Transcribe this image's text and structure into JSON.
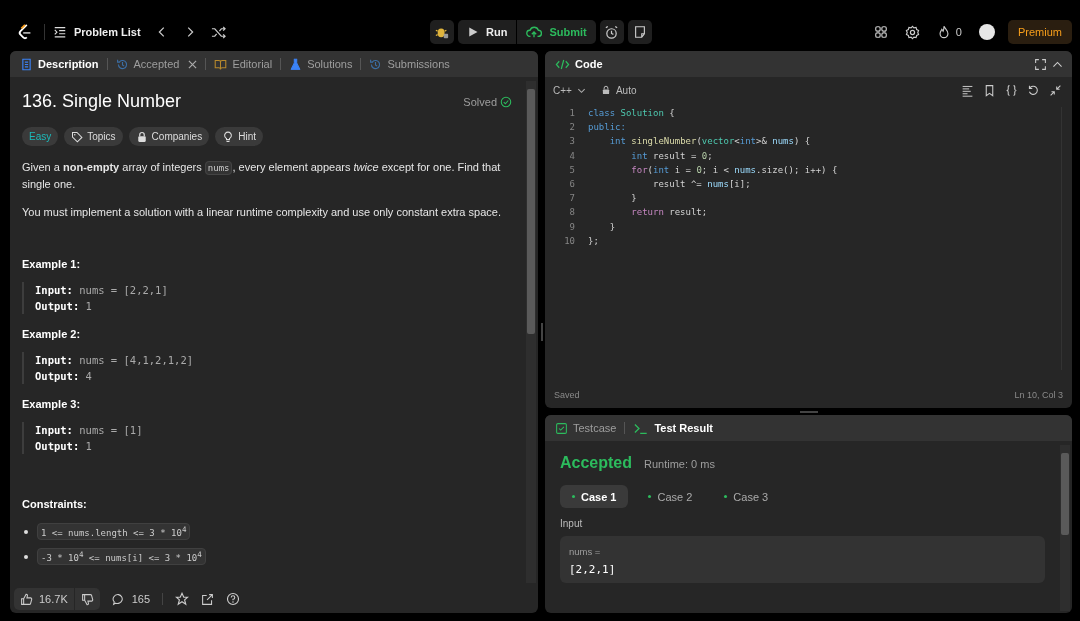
{
  "topbar": {
    "problem_list": "Problem List",
    "run": "Run",
    "submit": "Submit",
    "streak": "0",
    "premium": "Premium"
  },
  "description_panel": {
    "tabs": [
      {
        "label": "Description",
        "selected": true,
        "closable": false
      },
      {
        "label": "Accepted",
        "selected": false,
        "closable": true
      },
      {
        "label": "Editorial",
        "selected": false,
        "closable": false
      },
      {
        "label": "Solutions",
        "selected": false,
        "closable": false
      },
      {
        "label": "Submissions",
        "selected": false,
        "closable": false
      }
    ],
    "title": "136. Single Number",
    "status": "Solved",
    "tags": [
      {
        "label": "Easy",
        "kind": "difficulty"
      },
      {
        "label": "Topics",
        "kind": "tag"
      },
      {
        "label": "Companies",
        "kind": "lock"
      },
      {
        "label": "Hint",
        "kind": "bulb"
      }
    ],
    "paragraphs": [
      [
        {
          "kind": "text",
          "text": "Given a **non-empty** array of integers "
        },
        {
          "kind": "code",
          "text": "nums"
        },
        {
          "kind": "text",
          "text": ", every element appears *twice* except for one. Find that single one."
        }
      ],
      [
        {
          "kind": "text",
          "text": "You must implement a solution with a linear runtime complexity and use only constant extra space."
        }
      ]
    ],
    "examples": [
      {
        "title": "Example 1:",
        "lines": [
          {
            "label": "Input:",
            "value": "nums = [2,2,1]"
          },
          {
            "label": "Output:",
            "value": "1"
          }
        ]
      },
      {
        "title": "Example 2:",
        "lines": [
          {
            "label": "Input:",
            "value": "nums = [4,1,2,1,2]"
          },
          {
            "label": "Output:",
            "value": "4"
          }
        ]
      },
      {
        "title": "Example 3:",
        "lines": [
          {
            "label": "Input:",
            "value": "nums = [1]"
          },
          {
            "label": "Output:",
            "value": "1"
          }
        ]
      }
    ],
    "constraints_title": "Constraints:",
    "constraints": [
      "1 <= nums.length <= 3 * 10$^{4}$",
      "-3 * 10$^{4}$ <= nums[i] <= 3 * 10$^{4}$"
    ],
    "likes": "16.7K",
    "comments": "165"
  },
  "code_panel": {
    "title": "Code",
    "language": "C++",
    "mode": "Auto",
    "status": "Saved",
    "cursor": "Ln 10, Col 3",
    "lines": [
      {
        "number": "1",
        "tokens": [
          {
            "kind": "keyword",
            "text": "class "
          },
          {
            "kind": "type",
            "text": "Solution"
          },
          {
            "kind": "plain",
            "text": " {"
          }
        ]
      },
      {
        "number": "2",
        "tokens": [
          {
            "kind": "keyword",
            "text": "public:"
          }
        ]
      },
      {
        "number": "3",
        "tokens": [
          {
            "kind": "keyword",
            "text": "    int "
          },
          {
            "kind": "function",
            "text": "singleNumber"
          },
          {
            "kind": "plain",
            "text": "("
          },
          {
            "kind": "type",
            "text": "vector"
          },
          {
            "kind": "plain",
            "text": "<"
          },
          {
            "kind": "keyword",
            "text": "int"
          },
          {
            "kind": "plain",
            "text": ">& "
          },
          {
            "kind": "variable",
            "text": "nums"
          },
          {
            "kind": "plain",
            "text": ") {"
          }
        ]
      },
      {
        "number": "4",
        "tokens": [
          {
            "kind": "keyword",
            "text": "        int "
          },
          {
            "kind": "plain",
            "text": "result = "
          },
          {
            "kind": "number",
            "text": "0"
          },
          {
            "kind": "plain",
            "text": ";"
          }
        ]
      },
      {
        "number": "5",
        "tokens": [
          {
            "kind": "control",
            "text": "        for"
          },
          {
            "kind": "plain",
            "text": "("
          },
          {
            "kind": "keyword",
            "text": "int "
          },
          {
            "kind": "plain",
            "text": "i = "
          },
          {
            "kind": "number",
            "text": "0"
          },
          {
            "kind": "plain",
            "text": "; i < "
          },
          {
            "kind": "variable",
            "text": "nums"
          },
          {
            "kind": "plain",
            "text": ".size(); i++) {"
          }
        ]
      },
      {
        "number": "6",
        "tokens": [
          {
            "kind": "plain",
            "text": "            result ^= "
          },
          {
            "kind": "variable",
            "text": "nums"
          },
          {
            "kind": "plain",
            "text": "[i];"
          }
        ]
      },
      {
        "number": "7",
        "tokens": [
          {
            "kind": "plain",
            "text": "        }"
          }
        ]
      },
      {
        "number": "8",
        "tokens": [
          {
            "kind": "control",
            "text": "        return "
          },
          {
            "kind": "plain",
            "text": "result;"
          }
        ]
      },
      {
        "number": "9",
        "tokens": [
          {
            "kind": "plain",
            "text": "    }"
          }
        ]
      },
      {
        "number": "10",
        "tokens": [
          {
            "kind": "plain",
            "text": "};"
          }
        ]
      }
    ]
  },
  "result_panel": {
    "tabs": [
      {
        "label": "Testcase",
        "selected": false
      },
      {
        "label": "Test Result",
        "selected": true
      }
    ],
    "verdict": "Accepted",
    "runtime": "Runtime: 0 ms",
    "cases": [
      {
        "label": "Case 1",
        "selected": true,
        "passed": true
      },
      {
        "label": "Case 2",
        "selected": false,
        "passed": true
      },
      {
        "label": "Case 3",
        "selected": false,
        "passed": true
      }
    ],
    "input_label": "Input",
    "input_name": "nums =",
    "input_value": "[2,2,1]"
  }
}
